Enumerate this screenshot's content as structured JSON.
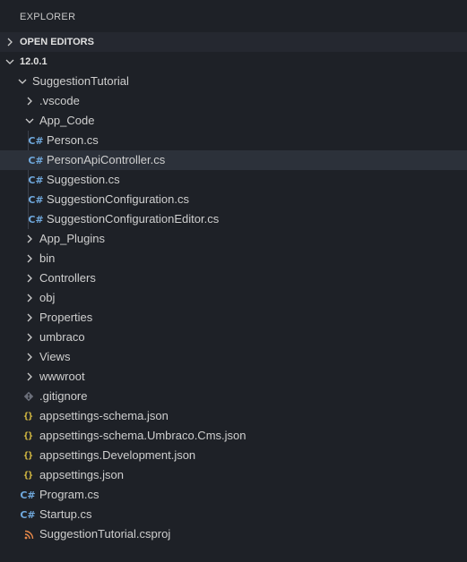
{
  "explorer": {
    "title": "EXPLORER",
    "open_editors_label": "OPEN EDITORS",
    "root_label": "12.0.1"
  },
  "tree": {
    "project": "SuggestionTutorial",
    "vscode": ".vscode",
    "app_code": "App_Code",
    "files_app_code": [
      "Person.cs",
      "PersonApiController.cs",
      "Suggestion.cs",
      "SuggestionConfiguration.cs",
      "SuggestionConfigurationEditor.cs"
    ],
    "folders": [
      "App_Plugins",
      "bin",
      "Controllers",
      "obj",
      "Properties",
      "umbraco",
      "Views",
      "wwwroot"
    ],
    "gitignore": ".gitignore",
    "json_files": [
      "appsettings-schema.json",
      "appsettings-schema.Umbraco.Cms.json",
      "appsettings.Development.json",
      "appsettings.json"
    ],
    "cs_files_root": [
      "Program.cs",
      "Startup.cs"
    ],
    "csproj": "SuggestionTutorial.csproj"
  },
  "icons": {
    "csharp_glyph": "C#",
    "json_glyph": "{}",
    "csharp_color": "#6fa8dc",
    "json_color": "#e2c543",
    "rss_color": "#e8894a",
    "git_color": "#6b6f7a"
  }
}
